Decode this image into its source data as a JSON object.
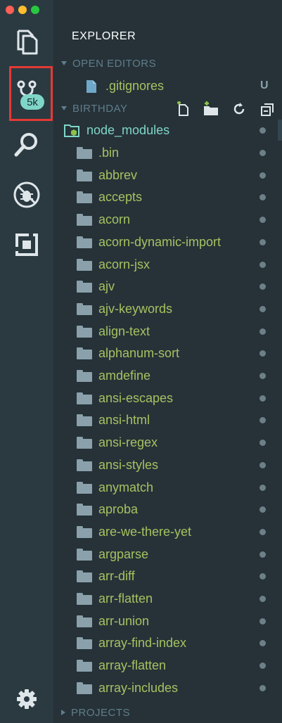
{
  "colors": {
    "background": "#263238",
    "activity_bar": "#2b3a41",
    "folder_text": "#a5c261",
    "section_text": "#607d8b",
    "accent_teal": "#7fd6c8",
    "highlight_red": "#e53935"
  },
  "window_controls": [
    "close",
    "minimize",
    "maximize"
  ],
  "activity_bar": {
    "items": [
      {
        "icon": "files-icon"
      },
      {
        "icon": "source-control-icon",
        "badge": "5k",
        "highlighted": true
      },
      {
        "icon": "search-icon"
      },
      {
        "icon": "debug-icon"
      },
      {
        "icon": "extensions-icon"
      }
    ],
    "bottom": {
      "icon": "gear-icon"
    }
  },
  "explorer": {
    "title": "EXPLORER",
    "open_editors": {
      "label": "OPEN EDITORS",
      "files": [
        {
          "name": ".gitignores",
          "status": "U"
        }
      ]
    },
    "project": {
      "label": "BIRTHDAY",
      "actions": [
        "new-file-icon",
        "new-folder-icon",
        "refresh-icon",
        "collapse-all-icon"
      ],
      "root_folder": "node_modules",
      "folders": [
        ".bin",
        "abbrev",
        "accepts",
        "acorn",
        "acorn-dynamic-import",
        "acorn-jsx",
        "ajv",
        "ajv-keywords",
        "align-text",
        "alphanum-sort",
        "amdefine",
        "ansi-escapes",
        "ansi-html",
        "ansi-regex",
        "ansi-styles",
        "anymatch",
        "aproba",
        "are-we-there-yet",
        "argparse",
        "arr-diff",
        "arr-flatten",
        "arr-union",
        "array-find-index",
        "array-flatten",
        "array-includes"
      ]
    },
    "projects_section": {
      "label": "PROJECTS"
    }
  }
}
